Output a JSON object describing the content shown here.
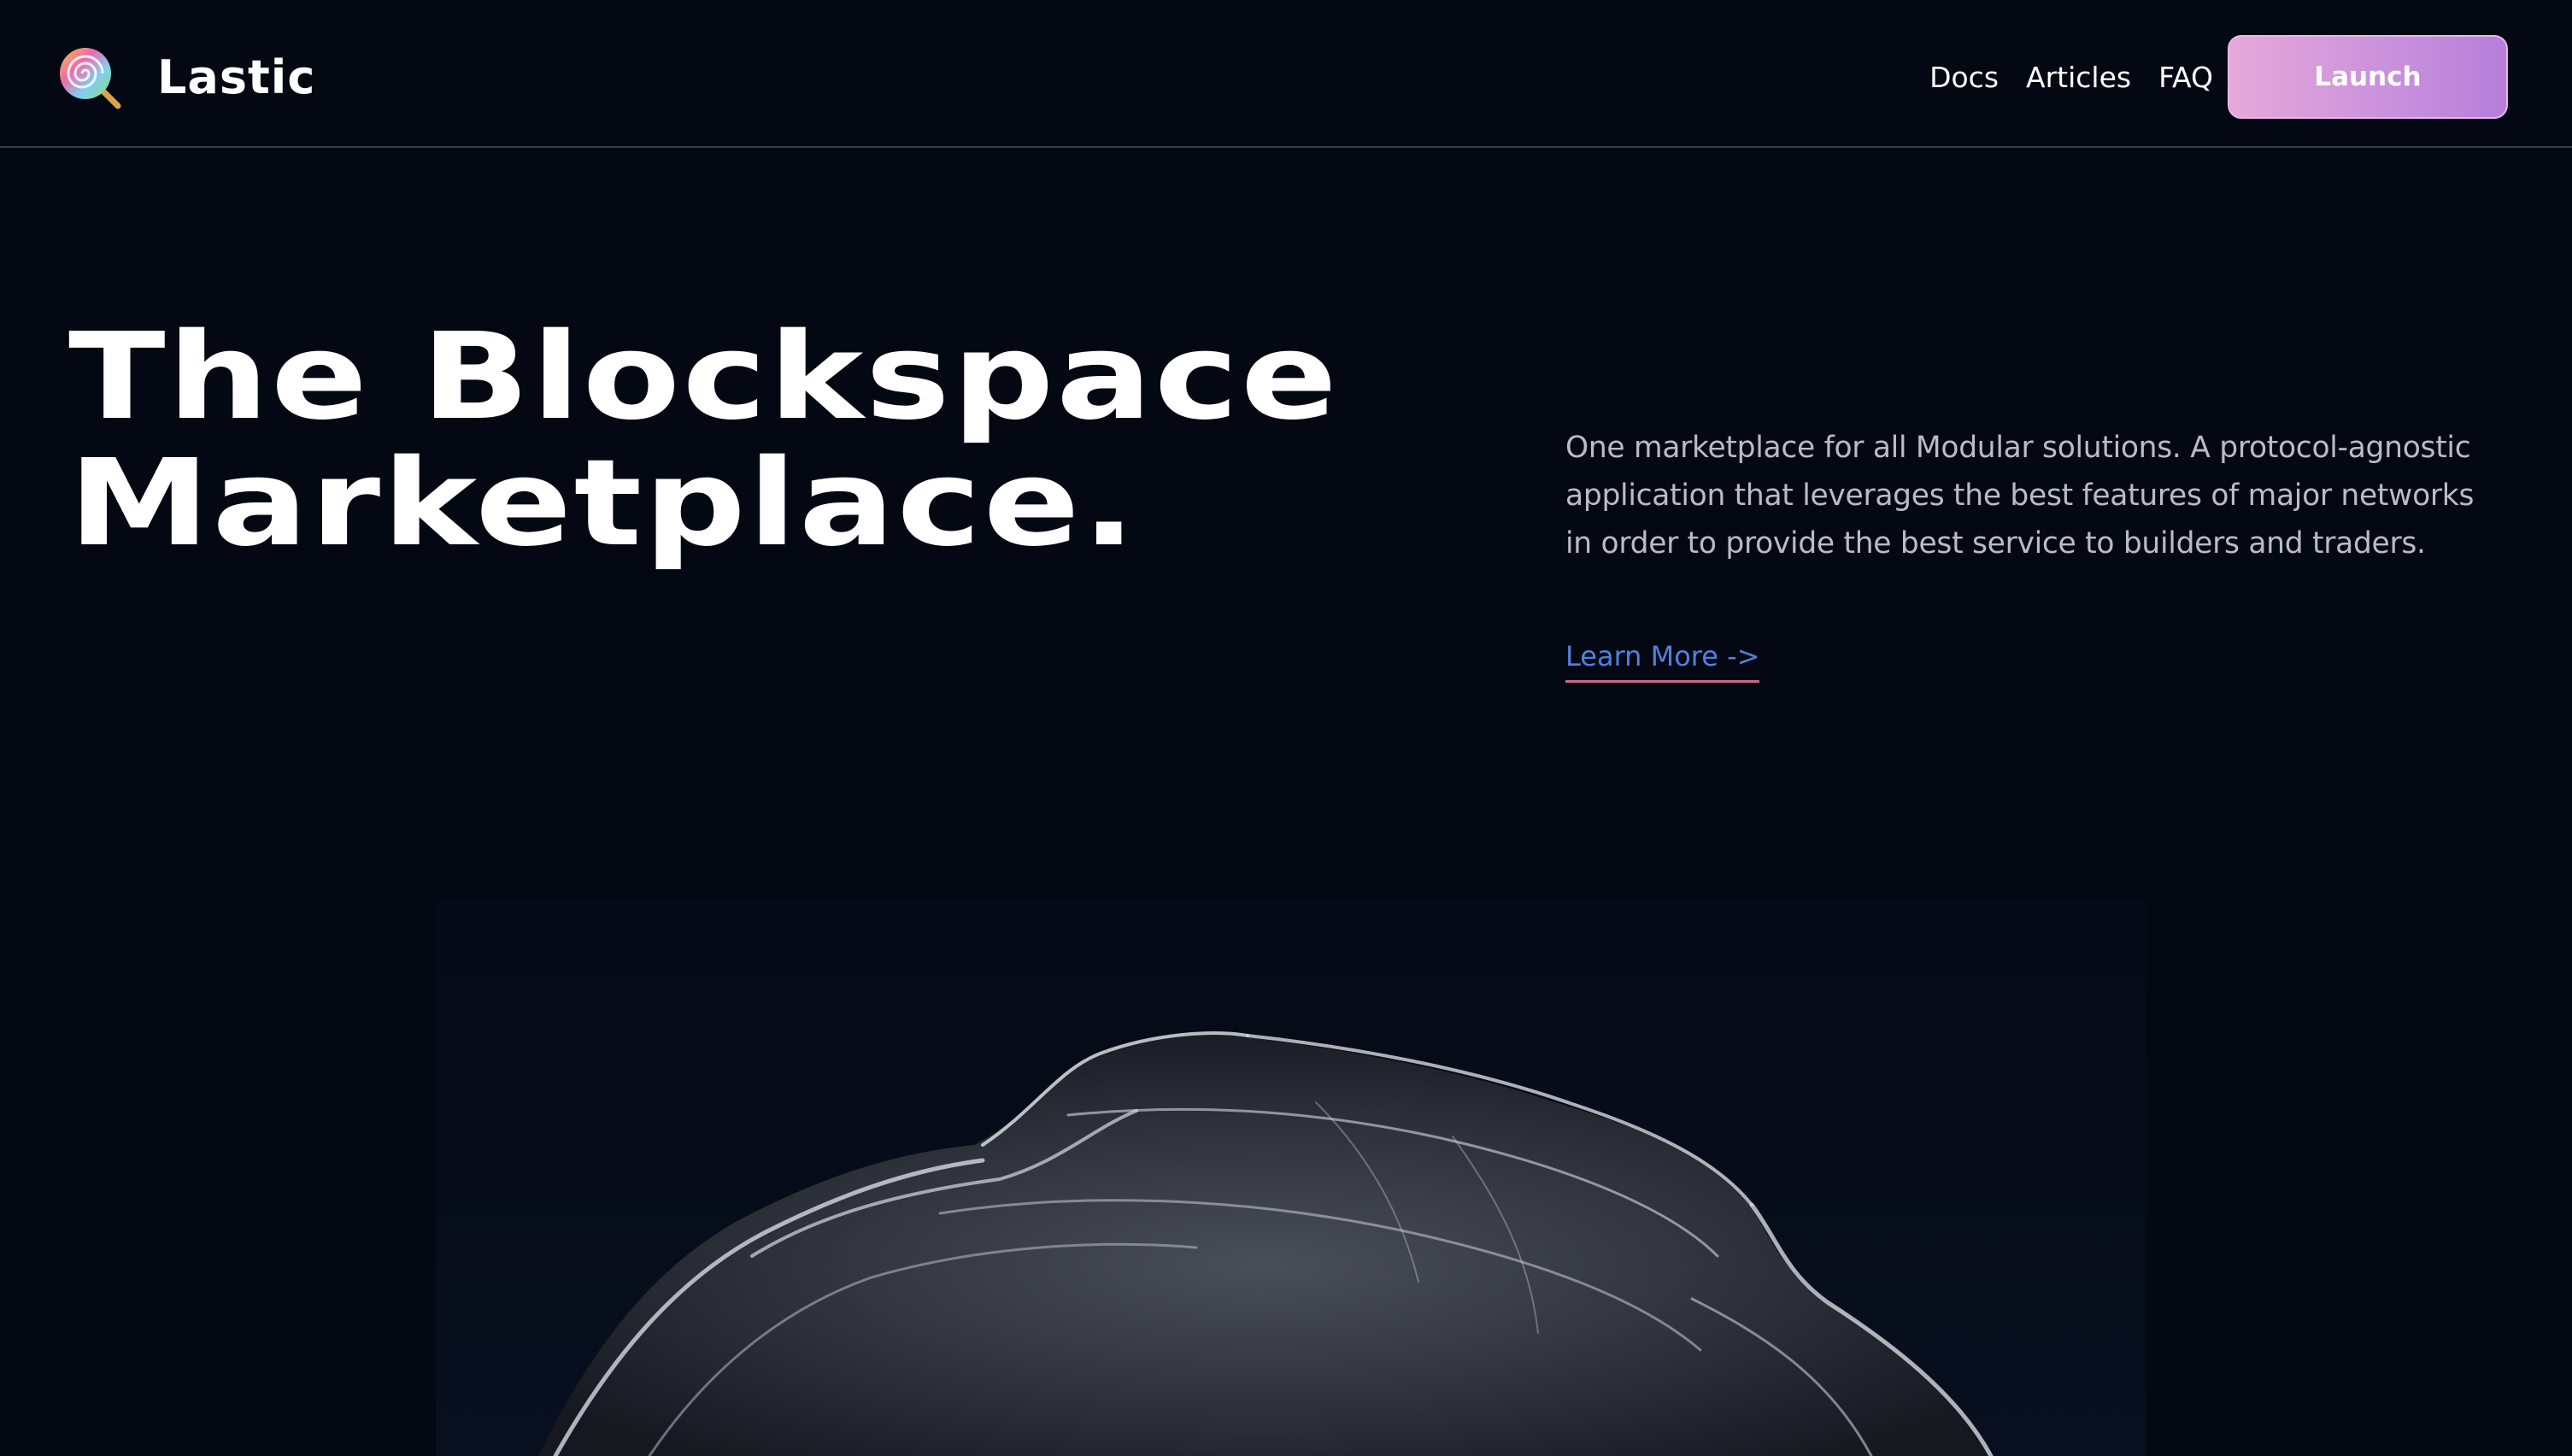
{
  "header": {
    "brand_name": "Lastic",
    "logo_icon": "lollipop-icon",
    "nav": [
      {
        "label": "Docs"
      },
      {
        "label": "Articles"
      },
      {
        "label": "FAQ"
      }
    ],
    "launch_label": "Launch"
  },
  "hero": {
    "title_line1": "The Blockspace",
    "title_line2": "Marketplace.",
    "description": "One marketplace for all Modular solutions. A protocol-agnostic application that leverages the best features of major networks in order to provide the best service to builders and traders.",
    "learn_more": "Learn More ->"
  },
  "colors": {
    "background": "#040812",
    "launch_gradient_start": "#e6a9d9",
    "launch_gradient_end": "#b67fd9",
    "link": "#4f82e0",
    "link_underline": "#c86a86"
  }
}
